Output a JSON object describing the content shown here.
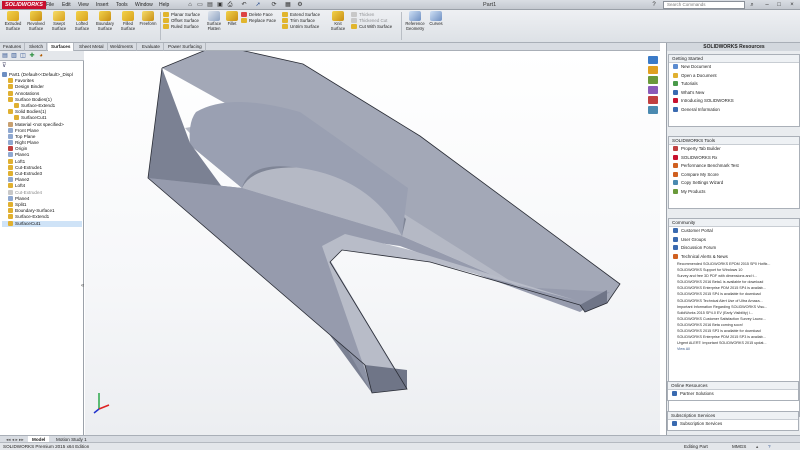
{
  "app": {
    "brand": "SOLIDWORKS",
    "doc_title": "Part1"
  },
  "menu": [
    "File",
    "Edit",
    "View",
    "Insert",
    "Tools",
    "Window",
    "Help"
  ],
  "search_placeholder": "Search Commands",
  "toolbar": {
    "big": [
      {
        "label": "Extruded Surface",
        "icon": "extruded-surface-icon"
      },
      {
        "label": "Revolved Surface",
        "icon": "revolved-surface-icon"
      },
      {
        "label": "Swept Surface",
        "icon": "swept-surface-icon"
      },
      {
        "label": "Lofted Surface",
        "icon": "lofted-surface-icon"
      },
      {
        "label": "Boundary Surface",
        "icon": "boundary-surface-icon"
      },
      {
        "label": "Filled Surface",
        "icon": "filled-surface-icon"
      },
      {
        "label": "Freeform",
        "icon": "freeform-icon"
      }
    ],
    "col1": [
      "Planar Surface",
      "Offset Surface",
      "Ruled Surface"
    ],
    "big2": [
      {
        "label": "Surface Flatten",
        "icon": "surface-flatten-icon"
      },
      {
        "label": "Fillet",
        "icon": "fillet-icon"
      }
    ],
    "col2": [
      "Delete Face",
      "Replace Face"
    ],
    "col3": [
      "Extend Surface",
      "Trim Surface",
      "Untrim Surface"
    ],
    "knit": "Knit Surface",
    "col4": [
      "Thicken",
      "Thickened Cut",
      "Cut With Surface"
    ],
    "ref": "Reference Geometry",
    "curves": "Curves"
  },
  "tabs": [
    "Features",
    "Sketch",
    "Surfaces",
    "Sheet Metal",
    "Weldments",
    "Evaluate",
    "Power Surfacing"
  ],
  "active_tab": "Surfaces",
  "tree": [
    {
      "label": "Part1  (Default<<Default>_Displ",
      "indent": 0
    },
    {
      "label": "Favorites",
      "indent": 1
    },
    {
      "label": "Design Binder",
      "indent": 1
    },
    {
      "label": "Annotations",
      "indent": 1
    },
    {
      "label": "Surface Bodies(1)",
      "indent": 1
    },
    {
      "label": "Surface-Extend1",
      "indent": 2
    },
    {
      "label": "Solid Bodies(1)",
      "indent": 1
    },
    {
      "label": "SurfaceCut1",
      "indent": 2
    },
    {
      "label": "Material <not specified>",
      "indent": 1
    },
    {
      "label": "Front Plane",
      "indent": 1
    },
    {
      "label": "Top Plane",
      "indent": 1
    },
    {
      "label": "Right Plane",
      "indent": 1
    },
    {
      "label": "Origin",
      "indent": 1
    },
    {
      "label": "Plane1",
      "indent": 1
    },
    {
      "label": "Loft1",
      "indent": 1
    },
    {
      "label": "Cut-Extrude1",
      "indent": 1
    },
    {
      "label": "Cut-Extrude3",
      "indent": 1
    },
    {
      "label": "Plane2",
      "indent": 1
    },
    {
      "label": "Loft4",
      "indent": 1
    },
    {
      "label": "Cut-Extrude4",
      "indent": 1
    },
    {
      "label": "Plane4",
      "indent": 1
    },
    {
      "label": "Split1",
      "indent": 1
    },
    {
      "label": "Boundary-Surface1",
      "indent": 1
    },
    {
      "label": "Surface-Extend1",
      "indent": 1
    },
    {
      "label": "SurfaceCut1",
      "indent": 1
    }
  ],
  "taskpane": {
    "title": "SOLIDWORKS Resources",
    "getting_started": {
      "title": "Getting Started",
      "items": [
        "New Document",
        "Open a Document",
        "Tutorials",
        "What's New",
        "Introducing SOLIDWORKS",
        "General Information"
      ]
    },
    "tools": {
      "title": "SOLIDWORKS Tools",
      "items": [
        "Property Tab Builder",
        "SOLIDWORKS Rx",
        "Performance Benchmark Test",
        "Compare My Score",
        "Copy Settings Wizard",
        "My Products"
      ]
    },
    "community": {
      "title": "Community",
      "items": [
        "Customer Portal",
        "User Groups",
        "Discussion Forum",
        "Technical Alerts & News"
      ]
    },
    "news": [
      "Recommended SOLIDWORKS EPDM 2015 SP0 Hotfix...",
      "SOLIDWORKS Support for Windows 10",
      "Survey and free 3D PDF with dimensions and t...",
      "SOLIDWORKS 2016 Beta1 is available for download",
      "SOLIDWORKS Enterprise PDM 2015 SP4 is availab...",
      "SOLIDWORKS 2015 SP4 is available for download",
      "SOLIDWORKS Technical Alert Use of Ultra Amaza...",
      "Important Information Regarding SOLIDWORKS Visu...",
      "SolidWorks 2015 SP4.0 EV (Early Visibility) i...",
      "SOLIDWORKS Customer Satisfaction Survey Launc...",
      "SOLIDWORKS 2016 Beta coming soon!",
      "SOLIDWORKS 2015 SP3 is available for download",
      "SOLIDWORKS Enterprise PDM 2015 SP3 is availab...",
      "Urgent ALERT: Important SOLIDWORKS 2015 updat..."
    ],
    "view_all": "View All",
    "online": {
      "title": "Online Resources",
      "items": [
        "Partner Solutions"
      ]
    },
    "subscription": {
      "title": "Subscription Services",
      "items": [
        "Subscription Services"
      ]
    }
  },
  "bottom_tabs": [
    "Model",
    "Motion Study 1"
  ],
  "active_bottom_tab": "Model",
  "status": {
    "edition": "SOLIDWORKS Premium 2015 x64 Edition",
    "mode": "Editing Part",
    "units": "MMGS"
  },
  "colors": {
    "brand_red": "#c8102e",
    "model_face": "#8f95a8",
    "accent_blue": "#2a4f8f"
  }
}
